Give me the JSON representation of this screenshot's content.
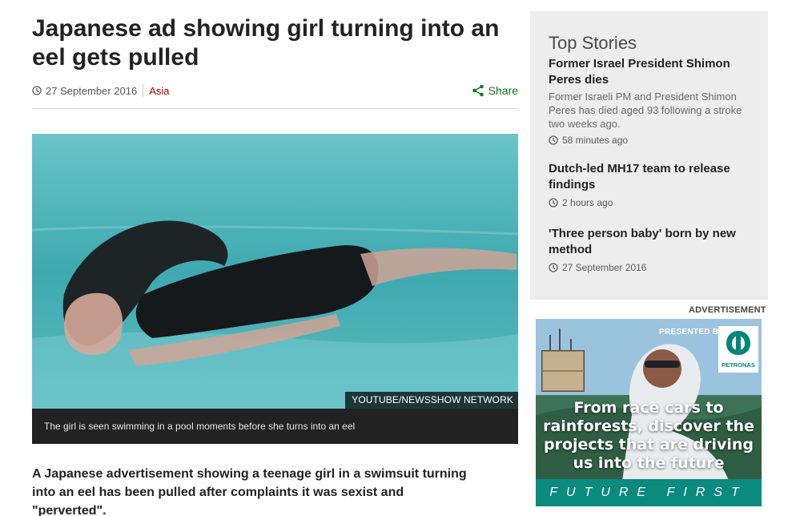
{
  "article": {
    "headline": "Japanese ad showing girl turning into an eel gets pulled",
    "date": "27 September 2016",
    "section": "Asia",
    "share_label": "Share",
    "image_credit": "YOUTUBE/NEWSSHOW NETWORK",
    "caption": "The girl is seen swimming in a pool moments before she turns into an eel",
    "lead": "A Japanese advertisement showing a teenage girl in a swimsuit turning into an eel has been pulled after complaints it was sexist and \"perverted\"."
  },
  "sidebar": {
    "title": "Top Stories",
    "stories": [
      {
        "headline": "Former Israel President Shimon Peres dies",
        "summary": "Former Israeli PM and President Shimon Peres has died aged 93 following a stroke two weeks ago.",
        "time": "58 minutes ago"
      },
      {
        "headline": "Dutch-led MH17 team to release findings",
        "summary": "",
        "time": "2 hours ago"
      },
      {
        "headline": "'Three person baby' born by new method",
        "summary": "",
        "time": "27 September 2016"
      }
    ]
  },
  "advert": {
    "label": "ADVERTISEMENT",
    "presented_by": "PRESENTED BY",
    "brand": "PETRONAS",
    "headline": "From race cars to rainforests, discover the projects that are driving us into the future",
    "footer": "FUTURE FIRST"
  },
  "colors": {
    "section_link": "#b80000",
    "share": "#117a22",
    "sidebar_bg": "#ededed",
    "ad_teal": "#0b8a7e"
  },
  "icons": [
    "clock-icon",
    "share-icon",
    "petronas-logo-icon"
  ]
}
